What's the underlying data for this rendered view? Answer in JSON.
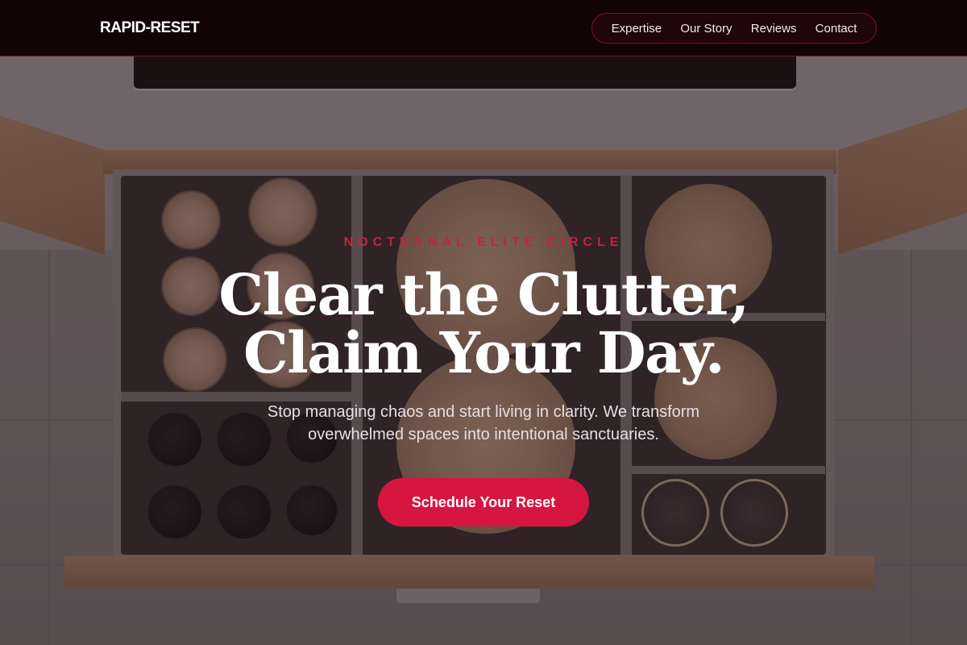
{
  "brand": {
    "name": "RAPID-RESET"
  },
  "nav": {
    "links": [
      {
        "label": "Expertise"
      },
      {
        "label": "Our Story"
      },
      {
        "label": "Reviews"
      },
      {
        "label": "Contact"
      }
    ]
  },
  "hero": {
    "kicker": "NOCTURNAL ELITE CIRCLE",
    "headline_line1": "Clear the Clutter,",
    "headline_line2": "Claim Your Day.",
    "subtitle_line1": "Stop managing chaos and start living in clarity. We transform",
    "subtitle_line2": "overwhelmed spaces into intentional sanctuaries.",
    "cta_label": "Schedule Your Reset",
    "background": "kitchen-drawer-photo"
  },
  "colors": {
    "accent": "#d61640",
    "kicker": "#c8213f",
    "nav_bg": "#120406",
    "nav_border": "#7a1424"
  }
}
